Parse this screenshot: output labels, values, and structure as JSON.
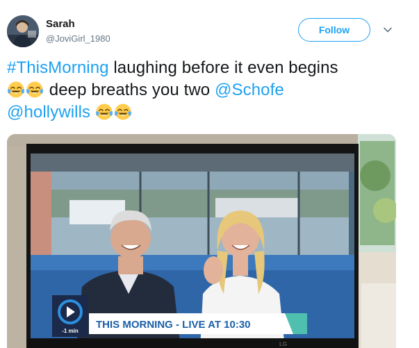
{
  "user": {
    "display_name": "Sarah",
    "handle": "@JoviGirl_1980"
  },
  "header": {
    "follow_label": "Follow"
  },
  "tweet": {
    "line1_hashtag": "#ThisMorning",
    "line1_text": " laughing before it even begins",
    "line2_text": " deep breaths you two ",
    "line2_mention": "@Schofe",
    "line3_mention": "@hollywills",
    "emoji_name": "face-with-tears-of-joy"
  },
  "media": {
    "description_icons": [
      "tv-set",
      "itv-logo"
    ],
    "banner_text": "THIS MORNING - LIVE AT 10:30",
    "logo_caption": "-1 min",
    "tv_brand": "LG",
    "colors": {
      "banner_bg": "#ffffff",
      "banner_text": "#1a5fa8",
      "logo_bg": "#1b2a4a",
      "logo_ring": "#2d8fe0"
    }
  },
  "colors": {
    "accent": "#1da1f2",
    "text": "#14171a",
    "muted": "#657786"
  }
}
